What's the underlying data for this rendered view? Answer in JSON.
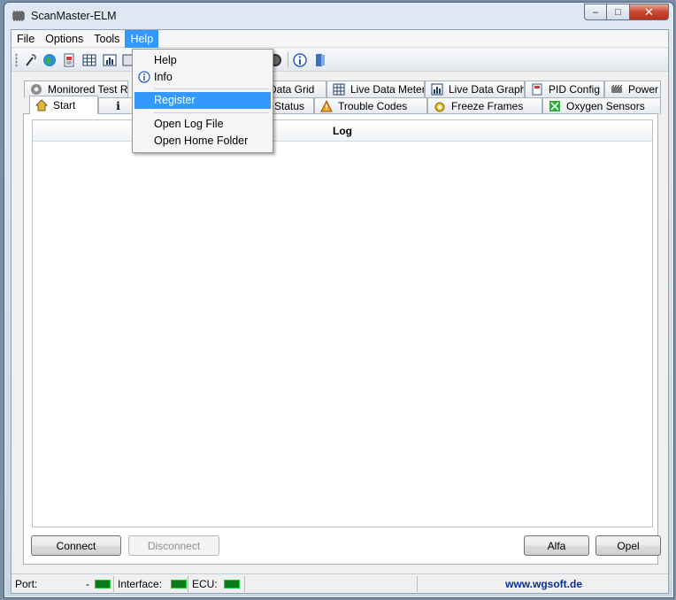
{
  "window": {
    "title": "ScanMaster-ELM",
    "min": "–",
    "max": "□",
    "close": "✕"
  },
  "menubar": [
    "File",
    "Options",
    "Tools",
    "Help"
  ],
  "help_menu": {
    "items": [
      "Help",
      "Info",
      "Register",
      "Open Log File",
      "Open Home Folder"
    ],
    "highlighted": "Register"
  },
  "tabs_row1": [
    "Monitored Test Res",
    "Data Grid",
    "Live Data Meter",
    "Live Data Graph",
    "PID Config",
    "Power"
  ],
  "tabs_row2": [
    "Start",
    "Status",
    "Trouble Codes",
    "Freeze Frames",
    "Oxygen Sensors"
  ],
  "log": {
    "header": "Log"
  },
  "buttons": {
    "connect": "Connect",
    "disconnect": "Disconnect",
    "alfa": "Alfa",
    "opel": "Opel"
  },
  "status": {
    "port_label": "Port:",
    "port_value": "-",
    "interface_label": "Interface:",
    "ecu_label": "ECU:",
    "website": "www.wgsoft.de"
  },
  "colors": {
    "menu_highlight": "#3399ff",
    "led": "#0f7a1a",
    "link": "#0b2f93"
  },
  "icons": [
    "connect-icon",
    "globe-icon",
    "document-icon",
    "grid-icon",
    "chart-icon",
    "gauge-icon",
    "info-icon",
    "book-icon"
  ]
}
